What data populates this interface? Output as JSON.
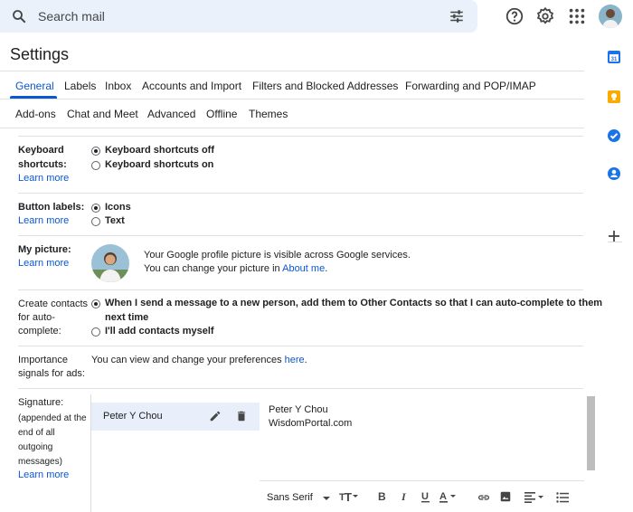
{
  "search": {
    "placeholder": "Search mail"
  },
  "settings": {
    "title": "Settings"
  },
  "tabs": {
    "row1": [
      "General",
      "Labels",
      "Inbox",
      "Accounts and Import",
      "Filters and Blocked Addresses",
      "Forwarding and POP/IMAP"
    ],
    "row2": [
      "Add-ons",
      "Chat and Meet",
      "Advanced",
      "Offline",
      "Themes"
    ],
    "active": "General"
  },
  "keyboard": {
    "label_line1": "Keyboard",
    "label_line2": "shortcuts:",
    "learn_more": "Learn more",
    "option_off": "Keyboard shortcuts off",
    "option_on": "Keyboard shortcuts on",
    "selected": "off"
  },
  "button_labels": {
    "label": "Button labels:",
    "learn_more": "Learn more",
    "option_icons": "Icons",
    "option_text": "Text",
    "selected": "icons"
  },
  "my_picture": {
    "label": "My picture:",
    "learn_more": "Learn more",
    "line1": "Your Google profile picture is visible across Google services.",
    "line2_prefix": "You can change your picture in",
    "line2_link": "About me",
    "line2_suffix": "."
  },
  "create_contacts": {
    "label_line1": "Create contacts",
    "label_line2": "for auto-",
    "label_line3": "complete:",
    "option_auto_line1": "When I send a message to a new person, add them to Other Contacts so that I can auto-complete to them",
    "option_auto_line2": "next time",
    "option_manual": "I'll add contacts myself",
    "selected": "auto"
  },
  "importance": {
    "label_line1": "Importance",
    "label_line2": "signals for ads:",
    "text_prefix": "You can view and change your preferences",
    "text_link": "here",
    "text_suffix": "."
  },
  "signature": {
    "label": "Signature:",
    "note_line1": "(appended at the",
    "note_line2": "end of all",
    "note_line3": "outgoing",
    "note_line4": "messages)",
    "learn_more": "Learn more",
    "item_name": "Peter Y Chou",
    "body_line1": "Peter Y Chou",
    "body_line2": "WisdomPortal.com",
    "font_select": "Sans Serif"
  },
  "colors": {
    "accent": "#0b57d0",
    "search_bg": "#eaf1fb",
    "selected_sig": "#e8eefa"
  },
  "icons": [
    "search-icon",
    "tune-icon",
    "help-icon",
    "gear-icon",
    "apps-icon",
    "calendar-icon",
    "keep-icon",
    "tasks-icon",
    "contacts-icon",
    "add-icon",
    "edit-icon",
    "delete-icon",
    "bold-icon",
    "italic-icon",
    "underline-icon",
    "link-icon",
    "image-icon",
    "align-icon",
    "list-icon"
  ]
}
